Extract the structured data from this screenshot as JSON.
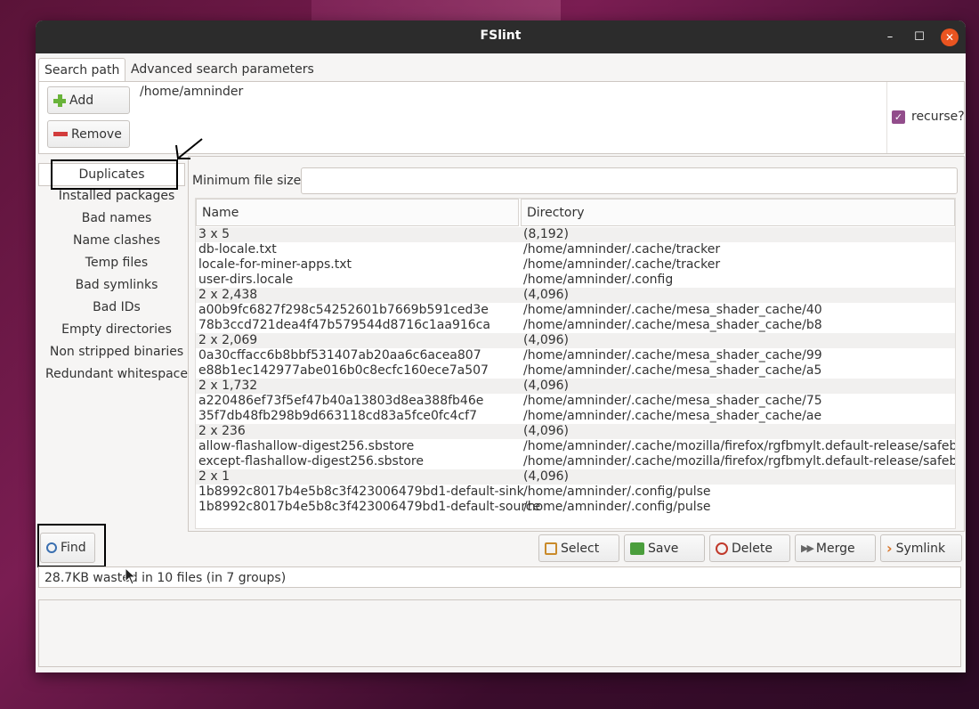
{
  "window": {
    "title": "FSlint",
    "minimize_glyph": "–",
    "maximize_glyph": "☐",
    "close_glyph": "✕"
  },
  "tabs": [
    "Search path",
    "Advanced search parameters"
  ],
  "search_path": {
    "add_label": "Add",
    "remove_label": "Remove",
    "path": "/home/amninder",
    "recurse_label": "recurse?",
    "recurse_checked": true
  },
  "sidebar": {
    "items": [
      "Duplicates",
      "Installed packages",
      "Bad names",
      "Name clashes",
      "Temp files",
      "Bad symlinks",
      "Bad IDs",
      "Empty directories",
      "Non stripped binaries",
      "Redundant whitespace"
    ],
    "selected": "Duplicates"
  },
  "main": {
    "min_size_label": "Minimum file size:",
    "min_size_value": "",
    "columns": [
      "Name",
      "Directory"
    ],
    "rows": [
      {
        "name": "3 x 5",
        "dir": "(8,192)",
        "group": true
      },
      {
        "name": "db-locale.txt",
        "dir": "/home/amninder/.cache/tracker",
        "group": false
      },
      {
        "name": "locale-for-miner-apps.txt",
        "dir": "/home/amninder/.cache/tracker",
        "group": false
      },
      {
        "name": "user-dirs.locale",
        "dir": "/home/amninder/.config",
        "group": false
      },
      {
        "name": "2 x 2,438",
        "dir": "(4,096)",
        "group": true
      },
      {
        "name": "a00b9fc6827f298c54252601b7669b591ced3e",
        "dir": "/home/amninder/.cache/mesa_shader_cache/40",
        "group": false
      },
      {
        "name": "78b3ccd721dea4f47b579544d8716c1aa916ca",
        "dir": "/home/amninder/.cache/mesa_shader_cache/b8",
        "group": false
      },
      {
        "name": "2 x 2,069",
        "dir": "(4,096)",
        "group": true
      },
      {
        "name": "0a30cffacc6b8bbf531407ab20aa6c6acea807",
        "dir": "/home/amninder/.cache/mesa_shader_cache/99",
        "group": false
      },
      {
        "name": "e88b1ec142977abe016b0c8ecfc160ece7a507",
        "dir": "/home/amninder/.cache/mesa_shader_cache/a5",
        "group": false
      },
      {
        "name": "2 x 1,732",
        "dir": "(4,096)",
        "group": true
      },
      {
        "name": "a220486ef73f5ef47b40a13803d8ea388fb46e",
        "dir": "/home/amninder/.cache/mesa_shader_cache/75",
        "group": false
      },
      {
        "name": "35f7db48fb298b9d663118cd83a5fce0fc4cf7",
        "dir": "/home/amninder/.cache/mesa_shader_cache/ae",
        "group": false
      },
      {
        "name": "2 x 236",
        "dir": "(4,096)",
        "group": true
      },
      {
        "name": "allow-flashallow-digest256.sbstore",
        "dir": "/home/amninder/.cache/mozilla/firefox/rgfbmylt.default-release/safeb",
        "group": false
      },
      {
        "name": "except-flashallow-digest256.sbstore",
        "dir": "/home/amninder/.cache/mozilla/firefox/rgfbmylt.default-release/safeb",
        "group": false
      },
      {
        "name": "2 x 1",
        "dir": "(4,096)",
        "group": true
      },
      {
        "name": "1b8992c8017b4e5b8c3f423006479bd1-default-sink",
        "dir": "/home/amninder/.config/pulse",
        "group": false
      },
      {
        "name": "1b8992c8017b4e5b8c3f423006479bd1-default-source",
        "dir": "/home/amninder/.config/pulse",
        "group": false
      }
    ]
  },
  "actions": {
    "find": "Find",
    "select": "Select",
    "save": "Save",
    "delete": "Delete",
    "merge": "Merge",
    "symlink": "Symlink"
  },
  "status": "28.7KB wasted in 10 files (in 7 groups)"
}
